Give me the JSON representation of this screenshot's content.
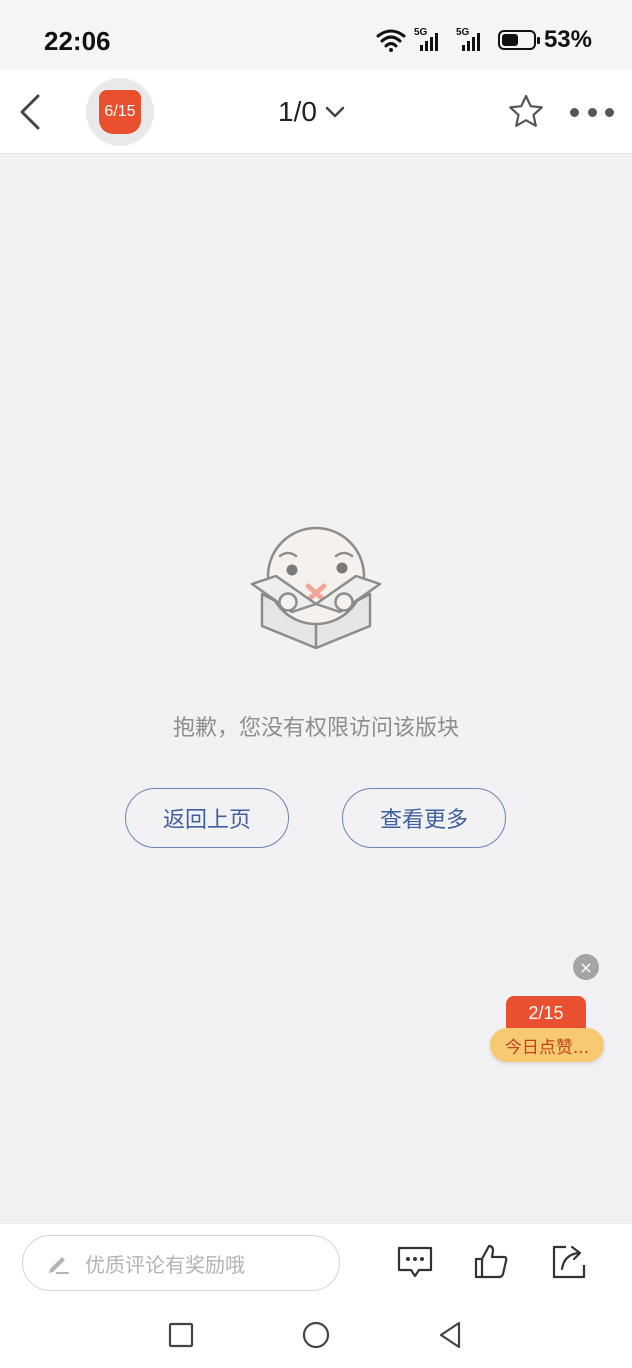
{
  "status_bar": {
    "time": "22:06",
    "signal_1_label": "5G",
    "signal_2_label": "5G",
    "battery_level": 0.53,
    "battery_text": "53%"
  },
  "nav": {
    "badge_text": "6/15",
    "page_indicator": "1/0"
  },
  "empty_state": {
    "message": "抱歉，您没有权限访问该版块",
    "back_button": "返回上页",
    "more_button": "查看更多"
  },
  "floating_widget": {
    "close_label": "×",
    "count": "2/15",
    "label": "今日点赞..."
  },
  "bottom_bar": {
    "comment_placeholder": "优质评论有奖励哦"
  },
  "colors": {
    "accent_red": "#e8502f",
    "link_blue": "#3f5f9f",
    "gold": "#f7ca72"
  }
}
